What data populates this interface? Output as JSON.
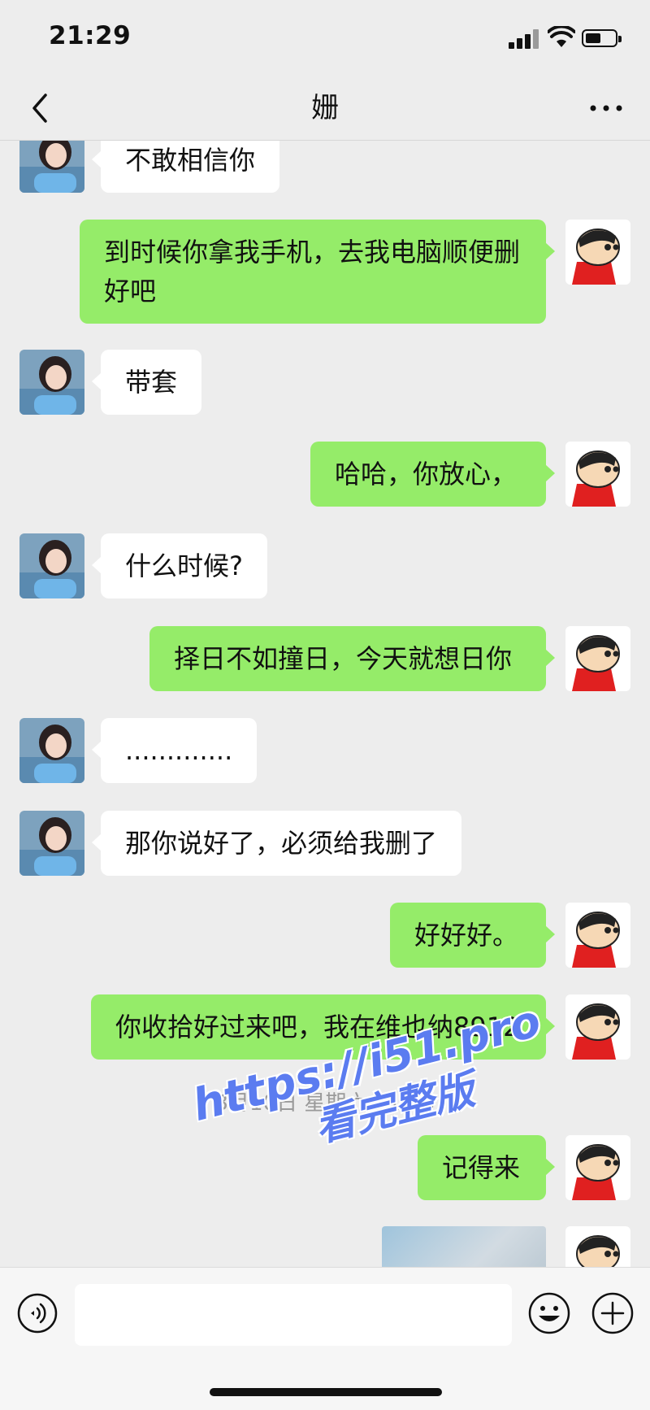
{
  "status_bar": {
    "time": "21:29"
  },
  "header": {
    "title": "姗"
  },
  "messages": [
    {
      "side": "in",
      "text": "不敢相信你"
    },
    {
      "side": "out",
      "text": "到时候你拿我手机，去我电脑顺便删好吧"
    },
    {
      "side": "in",
      "text": "带套"
    },
    {
      "side": "out",
      "text": "哈哈，你放心，"
    },
    {
      "side": "in",
      "text": "什么时候?"
    },
    {
      "side": "out",
      "text": "择日不如撞日，今天就想日你"
    },
    {
      "side": "in",
      "text": "............."
    },
    {
      "side": "in",
      "text": "那你说好了，必须给我删了"
    },
    {
      "side": "out",
      "text": "好好好。"
    },
    {
      "side": "out",
      "text": "你收拾好过来吧，我在维也纳8912"
    },
    {
      "side": "out",
      "text": "记得来"
    }
  ],
  "timestamp": "3月10日 星期六 21:45",
  "watermark": {
    "line1": "https://i51.pro",
    "line2": "看完整版"
  },
  "colors": {
    "outgoing_bubble": "#95ec69",
    "incoming_bubble": "#ffffff",
    "background": "#ededed",
    "watermark": "#5b7cf0"
  },
  "icons": {
    "back": "chevron-left-icon",
    "more": "more-dots-icon",
    "voice": "voice-icon",
    "emoji": "emoji-icon",
    "plus": "plus-icon"
  }
}
